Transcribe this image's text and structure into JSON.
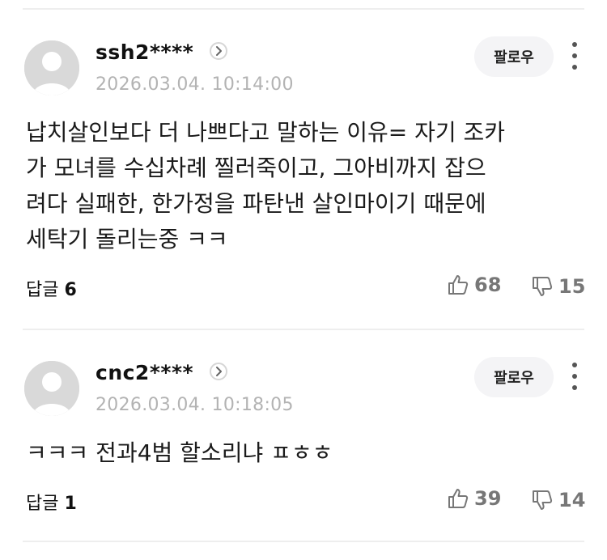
{
  "comments": [
    {
      "username": "ssh2****",
      "timestamp": "2026.03.04. 10:14:00",
      "follow_label": "팔로우",
      "body_lines": [
        "납치살인보다 더 나쁘다고 말하는 이유= 자기 조카",
        "가 모녀를 수십차례 찔러죽이고, 그아비까지 잡으",
        "려다 실패한, 한가정을 파탄낸 살인마이기 때문에",
        "세탁기 돌리는중 ㅋㅋ"
      ],
      "reply_label": "답글",
      "reply_count": "6",
      "likes": "68",
      "dislikes": "15"
    },
    {
      "username": "cnc2****",
      "timestamp": "2026.03.04. 10:18:05",
      "follow_label": "팔로우",
      "body_lines": [
        "ㅋㅋㅋ 전과4범 할소리냐 ㅍㅎㅎ"
      ],
      "reply_label": "답글",
      "reply_count": "1",
      "likes": "39",
      "dislikes": "14"
    }
  ],
  "icons": {
    "avatar": "default-avatar-icon",
    "profile_chevron": "chevron-right-icon",
    "more": "more-vertical-icon",
    "like": "thumbs-up-icon",
    "dislike": "thumbs-down-icon"
  },
  "colors": {
    "muted": "#b3b3b3",
    "follow_bg": "#f4f4f6",
    "divider": "#eeeeee"
  }
}
